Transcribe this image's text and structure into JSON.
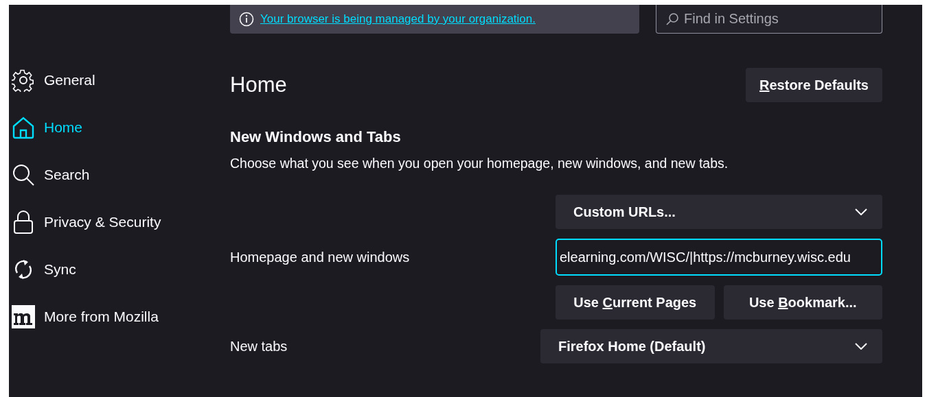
{
  "banner": {
    "link": "Your browser is being managed by your organization."
  },
  "search": {
    "placeholder": "Find in Settings"
  },
  "sidebar": {
    "items": [
      {
        "kind": "gear",
        "label": "General",
        "selected": false
      },
      {
        "kind": "home",
        "label": "Home",
        "selected": true
      },
      {
        "kind": "search",
        "label": "Search",
        "selected": false
      },
      {
        "kind": "lock",
        "label": "Privacy & Security",
        "selected": false
      },
      {
        "kind": "sync",
        "label": "Sync",
        "selected": false
      },
      {
        "kind": "mozilla",
        "label": "More from Mozilla",
        "selected": false
      }
    ]
  },
  "page": {
    "title": "Home",
    "restore_button": {
      "accesskey": "R",
      "after": "estore Defaults"
    }
  },
  "section": {
    "heading": "New Windows and Tabs",
    "description": "Choose what you see when you open your homepage, new windows, and new tabs."
  },
  "homepage": {
    "label": "Homepage and new windows",
    "select": "Custom URLs...",
    "url_value": "elearning.com/WISC/|https://mcburney.wisc.edu",
    "buttons": [
      {
        "before": "Use ",
        "accesskey": "C",
        "after": "urrent Pages"
      },
      {
        "before": "Use ",
        "accesskey": "B",
        "after": "ookmark..."
      }
    ]
  },
  "new_tabs": {
    "label": "New tabs",
    "select": "Firefox Home (Default)"
  }
}
